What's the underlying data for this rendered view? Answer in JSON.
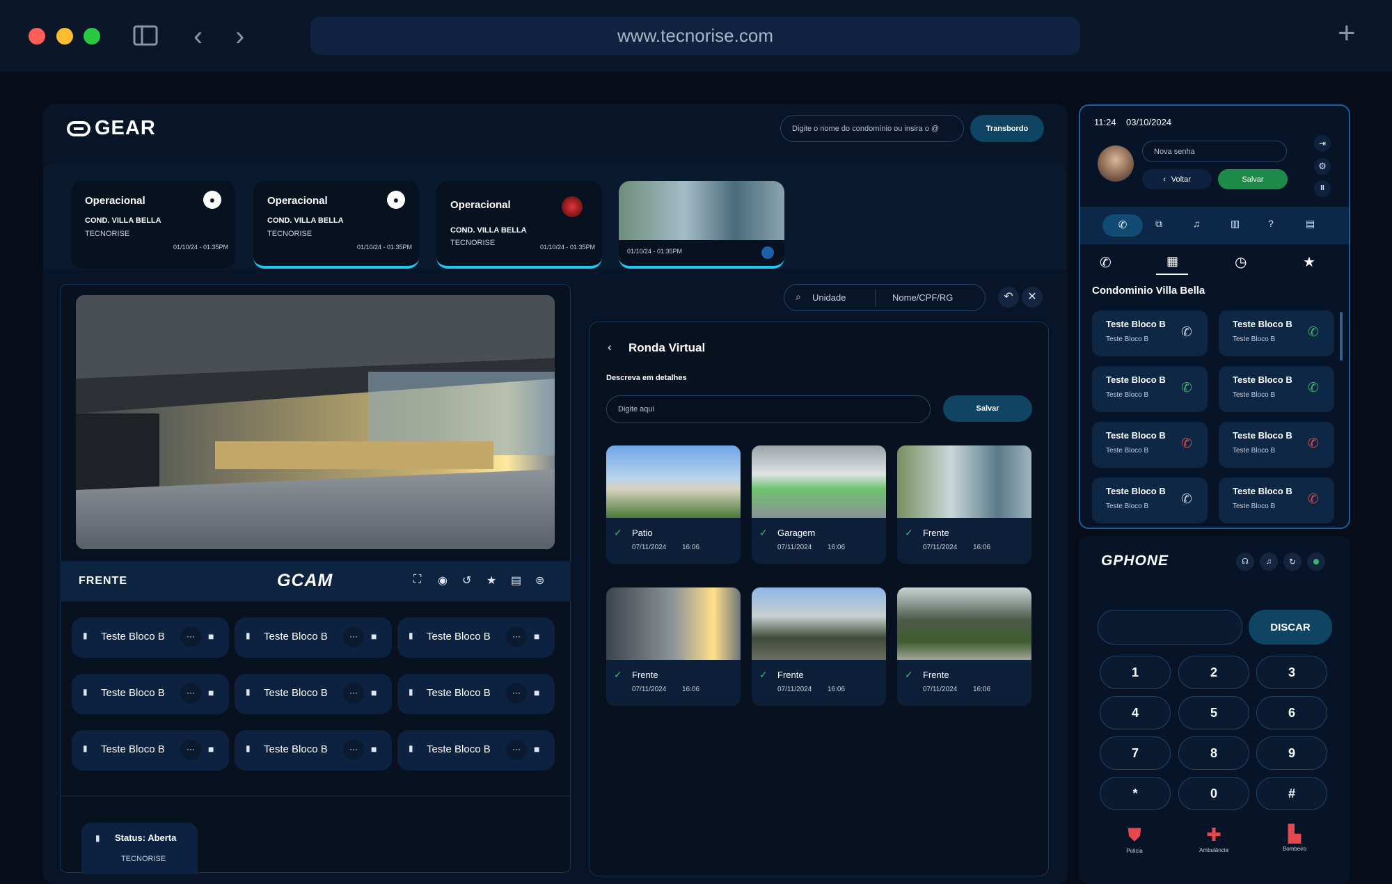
{
  "browser": {
    "url": "www.tecnorise.com",
    "new_tab_label": "+"
  },
  "header": {
    "logo": "GEAR",
    "search_placeholder": "Digite o nome do condomínio ou insira o @",
    "transbordo_label": "Transbordo"
  },
  "op_cards": [
    {
      "title": "Operacional",
      "cond": "COND. VILLA BELLA",
      "company": "TECNORISE",
      "time": "01/10/24 - 01:35PM"
    },
    {
      "title": "Operacional",
      "cond": "COND. VILLA BELLA",
      "company": "TECNORISE",
      "time": "01/10/24 - 01:35PM"
    },
    {
      "title": "Operacional",
      "cond": "COND. VILLA BELLA",
      "company": "TECNORISE",
      "time": "01/10/24 - 01:35PM"
    },
    {
      "time": "01/10/24 - 01:35PM"
    }
  ],
  "camera": {
    "label": "FRENTE",
    "logo": "GCAM"
  },
  "units": {
    "name": "Teste Bloco B",
    "more": "···"
  },
  "status": {
    "text": "Status: Aberta",
    "company": "TECNORISE"
  },
  "filters": {
    "unidade": "Unidade",
    "nome": "Nome/CPF/RG"
  },
  "ronda": {
    "title": "Ronda Virtual",
    "desc_label": "Descreva em detalhes",
    "input_placeholder": "Digite aqui",
    "save_label": "Salvar",
    "photos": [
      {
        "name": "Patio",
        "date": "07/11/2024",
        "time": "16:06"
      },
      {
        "name": "Garagem",
        "date": "07/11/2024",
        "time": "16:06"
      },
      {
        "name": "Frente",
        "date": "07/11/2024",
        "time": "16:06"
      },
      {
        "name": "Frente",
        "date": "07/11/2024",
        "time": "16:06"
      },
      {
        "name": "Frente",
        "date": "07/11/2024",
        "time": "16:06"
      },
      {
        "name": "Frente",
        "date": "07/11/2024",
        "time": "16:06"
      }
    ]
  },
  "user_panel": {
    "time": "11:24",
    "date": "03/10/2024",
    "password_placeholder": "Nova senha",
    "back_label": "Voltar",
    "save_label": "Salvar"
  },
  "contacts": {
    "condo_title": "Condominio Villa Bella",
    "items": [
      {
        "name": "Teste Bloco B",
        "sub": "Teste Bloco B",
        "call": "neutral"
      },
      {
        "name": "Teste Bloco B",
        "sub": "Teste Bloco B",
        "call": "green"
      },
      {
        "name": "Teste Bloco B",
        "sub": "Teste Bloco B",
        "call": "green"
      },
      {
        "name": "Teste Bloco B",
        "sub": "Teste Bloco B",
        "call": "green"
      },
      {
        "name": "Teste Bloco B",
        "sub": "Teste Bloco B",
        "call": "red"
      },
      {
        "name": "Teste Bloco B",
        "sub": "Teste Bloco B",
        "call": "red"
      },
      {
        "name": "Teste Bloco B",
        "sub": "Teste Bloco B",
        "call": "neutral"
      },
      {
        "name": "Teste Bloco B",
        "sub": "Teste Bloco B",
        "call": "red"
      }
    ]
  },
  "gphone": {
    "logo": "GPHONE",
    "dial_label": "DISCAR",
    "keys": [
      "1",
      "2",
      "3",
      "4",
      "5",
      "6",
      "7",
      "8",
      "9",
      "*",
      "0",
      "#"
    ],
    "emergency": [
      {
        "label": "Policia"
      },
      {
        "label": "Ambulância"
      },
      {
        "label": "Bombeiro"
      }
    ]
  },
  "colors": {
    "accent": "#1ec8f0",
    "green": "#3fb36b",
    "red": "#e5484d",
    "bg": "#060d19"
  }
}
